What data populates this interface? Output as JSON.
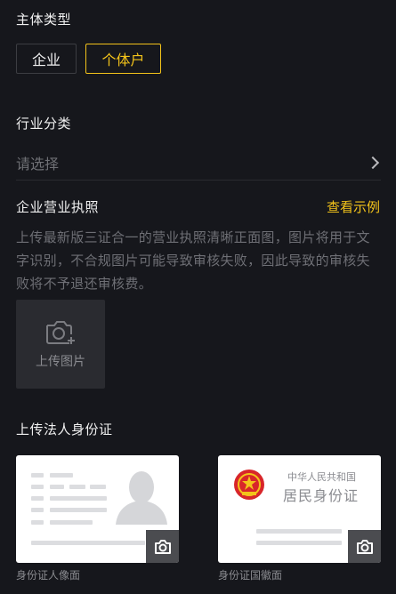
{
  "subject_type": {
    "label": "主体类型",
    "options": [
      "企业",
      "个体户"
    ],
    "selected": "个体户"
  },
  "industry": {
    "label": "行业分类",
    "placeholder": "请选择"
  },
  "business_license": {
    "label": "企业营业执照",
    "example_link": "查看示例",
    "description": "上传最新版三证合一的营业执照清晰正面图，图片将用于文字识别，不合规图片可能导致审核失败，因此导致的审核失败将不予退还审核费。",
    "upload_label": "上传图片"
  },
  "legal_id": {
    "label": "上传法人身份证",
    "front_caption": "身份证人像面",
    "back_caption": "身份证国徽面",
    "back_card_title_small": "中华人民共和国",
    "back_card_title_large": "居民身份证"
  },
  "colors": {
    "background": "#16171c",
    "accent": "#f3c31a",
    "muted_text": "#6e6f75"
  }
}
